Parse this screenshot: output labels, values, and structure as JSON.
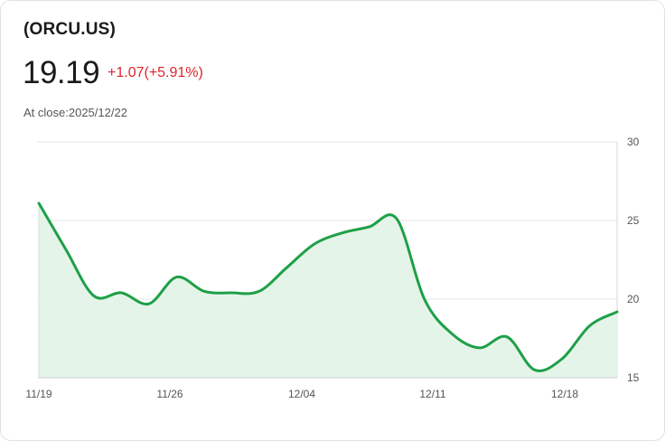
{
  "header": {
    "ticker": "(ORCU.US)",
    "price": "19.19",
    "change": "+1.07(+5.91%)",
    "close_label": "At close:2025/12/22"
  },
  "colors": {
    "line": "#1ea048",
    "fill": "#e5f4e9",
    "change": "#e0242b",
    "grid": "#e6e6e6"
  },
  "chart_data": {
    "type": "area",
    "x_ticks": [
      "11/19",
      "11/26",
      "12/04",
      "12/11",
      "12/18"
    ],
    "y_ticks": [
      15,
      20,
      25,
      30
    ],
    "ylim": [
      15,
      30
    ],
    "y_axis_position": "right",
    "grid": true,
    "series": [
      {
        "values": [
          26.1,
          23.1,
          20.2,
          20.4,
          19.7,
          21.4,
          20.5,
          20.4,
          20.5,
          22.0,
          23.5,
          24.2,
          24.6,
          25.1,
          20.0,
          17.8,
          16.9,
          17.6,
          15.5,
          16.2,
          18.3,
          19.19
        ]
      }
    ]
  }
}
